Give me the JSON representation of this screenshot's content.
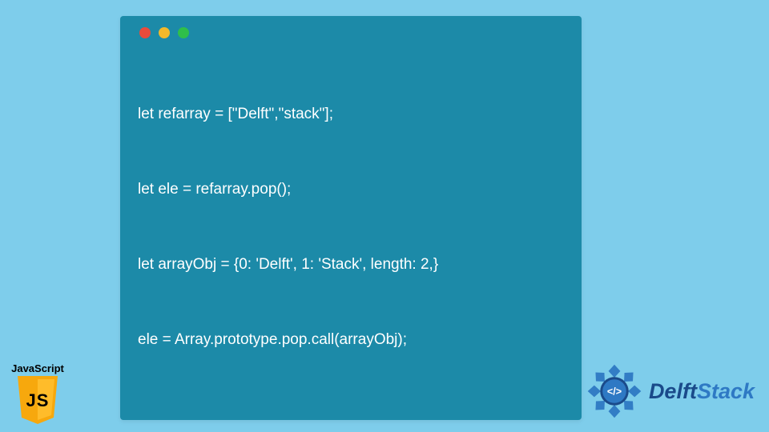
{
  "colors": {
    "background": "#7ecdeb",
    "panel": "#1c8aa8",
    "codeText": "#ffffff",
    "dotRed": "#e94b3c",
    "dotYellow": "#f2b92b",
    "dotGreen": "#2fbf4a",
    "jsShield": "#f7a80d",
    "delftDark": "#1a4a8a",
    "delftLight": "#2e79c4"
  },
  "code": {
    "lines": [
      "let refarray = [\"Delft\",\"stack\"];",
      "let ele = refarray.pop();",
      "let arrayObj = {0: 'Delft', 1: 'Stack', length: 2,}",
      "ele = Array.prototype.pop.call(arrayObj);"
    ]
  },
  "jsBadge": {
    "label": "JavaScript",
    "letters": "JS"
  },
  "delftLogo": {
    "wordDark": "Delft",
    "wordLight": "Stack",
    "emblemGlyph": "</>"
  }
}
